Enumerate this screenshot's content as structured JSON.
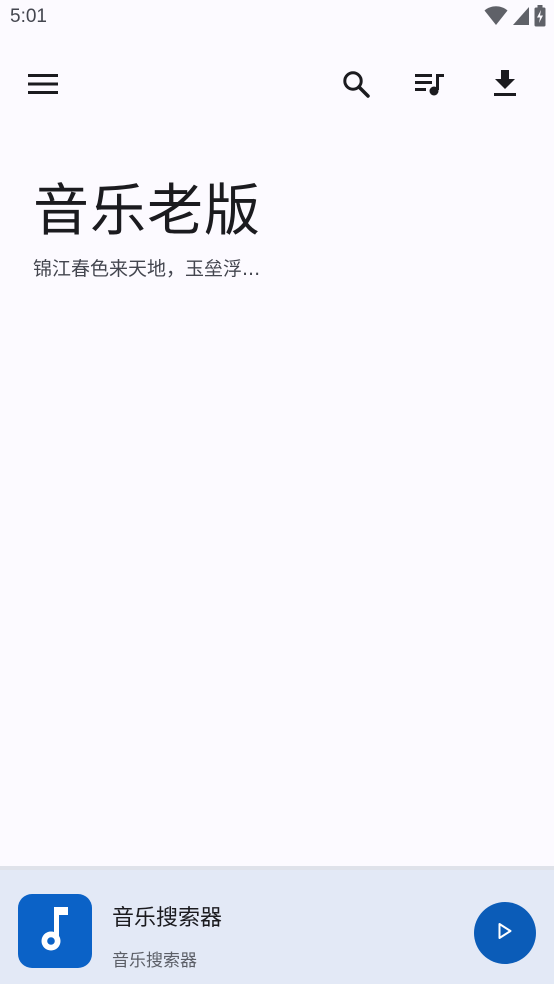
{
  "status_bar": {
    "time": "5:01",
    "icons": [
      "wifi-icon",
      "cellular-signal-icon",
      "battery-charging-icon"
    ]
  },
  "top_bar": {
    "menu_icon": "menu-icon",
    "actions": [
      "search-icon",
      "playlist-icon",
      "download-icon"
    ]
  },
  "hero": {
    "title": "音乐老版",
    "subtitle": "锦江春色来天地，玉垒浮..."
  },
  "mini_player": {
    "track_title": "音乐搜索器",
    "track_artist": "音乐搜索器",
    "album_art_icon": "music-note-icon",
    "play_icon": "play-icon"
  },
  "colors": {
    "background": "#fcfaff",
    "player_background": "#e3e9f6",
    "accent": "#0b5cb8",
    "art_background": "#0b62c7"
  }
}
